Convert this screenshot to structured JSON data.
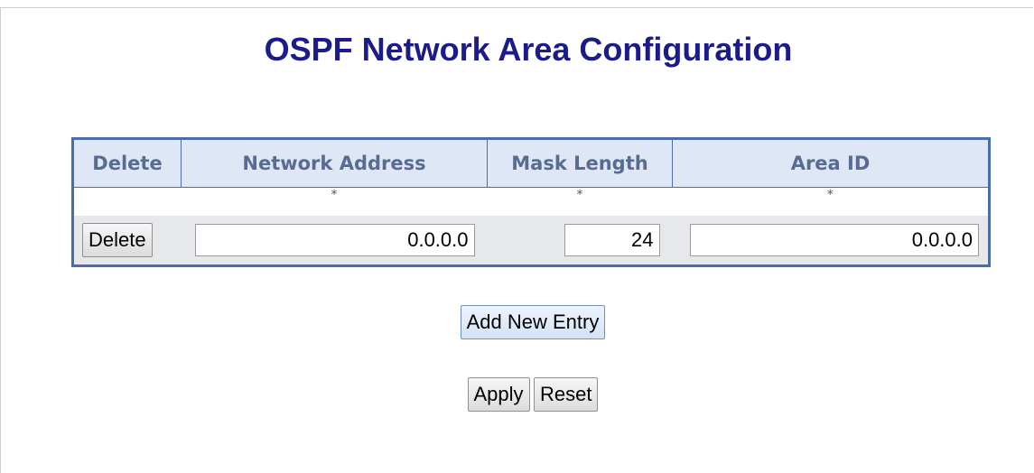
{
  "page": {
    "title": "OSPF Network Area Configuration"
  },
  "table": {
    "headers": {
      "delete": "Delete",
      "network_address": "Network Address",
      "mask_length": "Mask Length",
      "area_id": "Area ID"
    },
    "required_marks": {
      "network_address": "*",
      "mask_length": "*",
      "area_id": "*"
    },
    "rows": [
      {
        "delete_label": "Delete",
        "network_address": "0.0.0.0",
        "mask_length": "24",
        "area_id": "0.0.0.0"
      }
    ]
  },
  "buttons": {
    "add_new_entry": "Add New Entry",
    "apply": "Apply",
    "reset": "Reset"
  },
  "colors": {
    "title": "#1b1b8a",
    "header_bg": "#dfe7f7",
    "header_text": "#576b93",
    "border": "#4a6ea9",
    "row_bg": "#e6e8ec"
  }
}
